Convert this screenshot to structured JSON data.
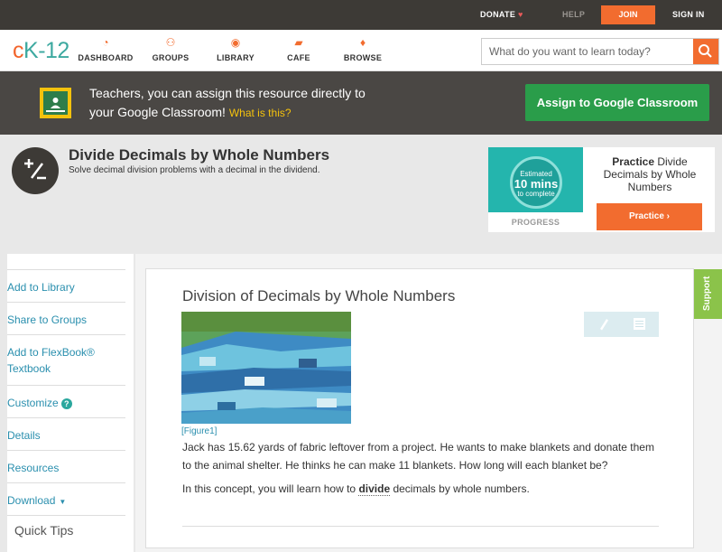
{
  "topbar": {
    "donate": "DONATE",
    "help": "HELP",
    "join": "JOIN",
    "signin": "SIGN IN"
  },
  "brand": {
    "logo_c": "c",
    "logo_k": "K",
    "logo_n": "-12"
  },
  "nav": {
    "dashboard": "DASHBOARD",
    "groups": "GROUPS",
    "library": "LIBRARY",
    "cafe": "CAFE",
    "browse": "BROWSE"
  },
  "search": {
    "placeholder": "What do you want to learn today?"
  },
  "teacher_banner": {
    "line1": "Teachers, you can assign this resource directly to",
    "line2": "your Google Classroom!",
    "what": "What is this?",
    "assign_button": "Assign to Google Classroom"
  },
  "module": {
    "title": "Divide Decimals by Whole Numbers",
    "description": "Solve decimal division problems with a decimal in the dividend."
  },
  "practice_card": {
    "estimated": "Estimated",
    "mins": "10 mins",
    "to_complete": "to complete",
    "progress": "PROGRESS",
    "title_bold": "Practice",
    "title_rest": "Divide Decimals by Whole Numbers",
    "button": "Practice"
  },
  "sidebar": {
    "items": [
      "Add to Library",
      "Share to Groups",
      "Add to FlexBook® Textbook",
      "Customize",
      "Details",
      "Resources",
      "Download"
    ],
    "quick_tips": "Quick Tips"
  },
  "content": {
    "title": "Division of Decimals by Whole Numbers",
    "figure_caption": "[Figure1]",
    "paragraph1": "Jack has 15.62 yards of fabric leftover from a project. He wants to make blankets and donate them to the animal shelter. He thinks he can make 11 blankets. How long will each blanket be?",
    "p2_before": "In this concept, you will learn how to ",
    "p2_term": "divide",
    "p2_after": " decimals by whole numbers."
  },
  "support_tab": "Support"
}
